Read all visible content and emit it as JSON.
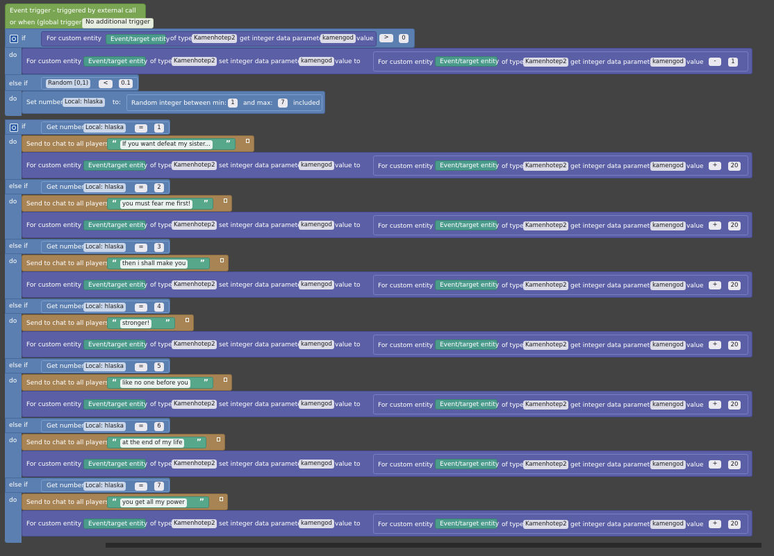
{
  "event": {
    "title": "Event trigger - triggered by external call",
    "or_when": "or when (global trigger):",
    "trigger_value": "No additional trigger"
  },
  "kw": {
    "if": "if",
    "else_if": "else if",
    "do": "do",
    "for_custom_entity": "For custom entity",
    "event_target_entity": "Event/target entity",
    "of_type": "of type",
    "entity_type": "Kamenhotep2",
    "get_integer": "get integer data parameter",
    "set_integer": "set integer data parameter",
    "param": "kamengod",
    "value": "value",
    "value_to": "value to",
    "send_to_chat": "Send to chat to all players:",
    "get_number": "Get number",
    "set_number": "Set number",
    "local_hlaska": "Local: hlaska",
    "to": "to:",
    "random_between": "Random integer between min:",
    "and_max": "and max:",
    "included": "included",
    "random_fn": "Random [0,1)",
    "op_gt": ">",
    "op_lt": "<",
    "op_eq": "=",
    "op_minus": "-",
    "op_plus": "+",
    "open_quote": "“",
    "close_quote": "”",
    "dropdown_arrow": "˅"
  },
  "first_if": {
    "compare_value": "0",
    "decrement": "1"
  },
  "random_branch": {
    "threshold": "0.1",
    "min": "1",
    "max": "7"
  },
  "increment": "20",
  "branches": [
    {
      "index": "1",
      "message": "If you want defeat my sister..."
    },
    {
      "index": "2",
      "message": "you must fear me first!"
    },
    {
      "index": "3",
      "message": "then i shall make you"
    },
    {
      "index": "4",
      "message": "stronger!"
    },
    {
      "index": "5",
      "message": "like no one before you"
    },
    {
      "index": "6",
      "message": "at the end of my life"
    },
    {
      "index": "7",
      "message": "you get all my power"
    }
  ],
  "colors": {
    "workspace": "#434343",
    "event_green": "#7aa653",
    "logic_blue": "#5b7fb0",
    "entity_purple": "#5b5fa6",
    "chat_brown": "#a88455",
    "string_green": "#57a88a",
    "entity_teal": "#4a9b8c"
  }
}
